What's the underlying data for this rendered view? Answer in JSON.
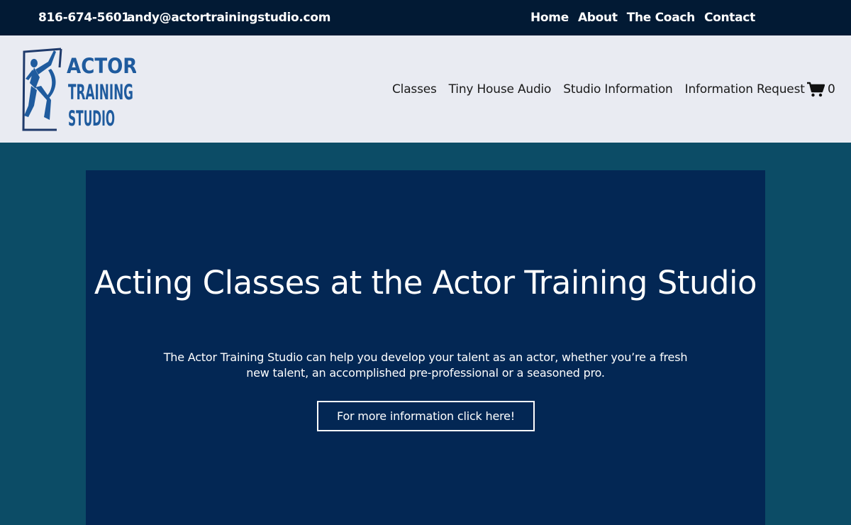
{
  "topbar": {
    "phone": "816-674-5601",
    "email": "andy@actortrainingstudio.com",
    "nav": [
      {
        "label": "Home"
      },
      {
        "label": "About"
      },
      {
        "label": "The Coach"
      },
      {
        "label": "Contact"
      }
    ]
  },
  "header": {
    "logo": {
      "icon": "dancer-figure-logo",
      "lines": [
        "ACTOR",
        "TRAINING",
        "STUDIO"
      ]
    },
    "nav": [
      {
        "label": "Classes"
      },
      {
        "label": "Tiny House Audio"
      },
      {
        "label": "Studio Information"
      },
      {
        "label": "Information Request"
      }
    ],
    "cart": {
      "icon": "cart-icon",
      "count": "0"
    }
  },
  "hero": {
    "title": "Acting Classes at the Actor Training Studio",
    "description": "The Actor Training Studio can help you develop your talent as an actor, whether you’re a fresh new talent, an accomplished pre-professional or a seasoned pro.",
    "cta_label": "For more information click here!"
  },
  "colors": {
    "topbar_bg": "#021a34",
    "header_bg": "#e9ebf2",
    "page_bg": "#0c4c66",
    "hero_bg": "#032754",
    "logo_blue": "#1f5b9e"
  }
}
